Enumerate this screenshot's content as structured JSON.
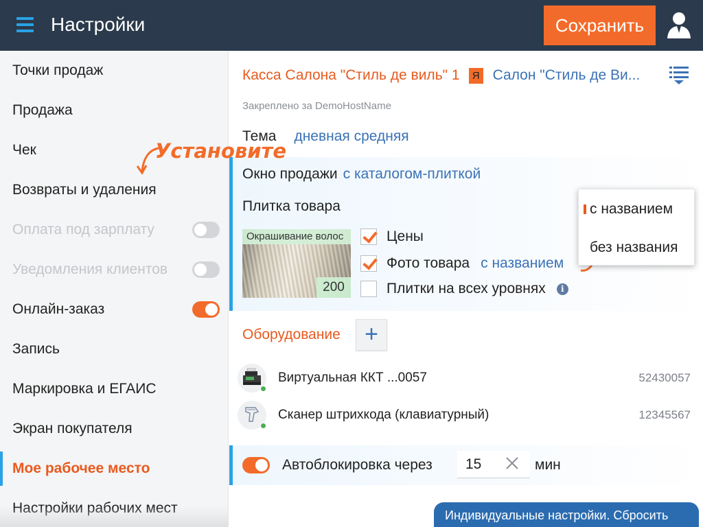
{
  "header": {
    "title": "Настройки",
    "save_label": "Сохранить"
  },
  "sidebar": {
    "items": [
      {
        "label": "Точки продаж"
      },
      {
        "label": "Продажа"
      },
      {
        "label": "Чек"
      },
      {
        "label": "Возвраты и удаления"
      },
      {
        "label": "Оплата под зарплату",
        "disabled": true,
        "toggle": false
      },
      {
        "label": "Уведомления клиентов",
        "disabled": true,
        "toggle": false
      },
      {
        "label": "Онлайн-заказ",
        "toggle": true
      },
      {
        "label": "Запись"
      },
      {
        "label": "Маркировка и ЕГАИС"
      },
      {
        "label": "Экран покупателя"
      },
      {
        "label": "Мое рабочее место",
        "active": true
      },
      {
        "label": "Настройки рабочих мест"
      }
    ]
  },
  "workplace": {
    "cash_name": "Касса Салона \"Стиль де виль\" 1",
    "badge": "Я",
    "salon": "Салон \"Стиль де Ви...",
    "pinned": "Закреплено за DemoHostName",
    "theme_label": "Тема",
    "theme_value": "дневная средняя"
  },
  "sale_window": {
    "label": "Окно продажи",
    "value": "с каталогом-плиткой",
    "tile_label": "Плитка товара",
    "hint": "Установите",
    "tile_preview": {
      "title": "Окрашивание волос",
      "price": "200"
    },
    "options": [
      {
        "label": "Цены",
        "checked": true
      },
      {
        "label": "Фото товара",
        "checked": true,
        "link": "с названием"
      },
      {
        "label": "Плитки на всех уровнях",
        "checked": false,
        "info_icon": "i"
      }
    ]
  },
  "popup": {
    "options": [
      "с названием",
      "без названия"
    ],
    "selected": "с названием"
  },
  "equipment": {
    "title": "Оборудование",
    "add_label": "+",
    "devices": [
      {
        "name": "Виртуальная ККТ ...0057",
        "serial": "52430057",
        "icon": "printer-icon",
        "status_color": "#4caf50"
      },
      {
        "name": "Сканер штрихкода (клавиатурный)",
        "serial": "12345567",
        "icon": "scanner-icon",
        "status_color": "#4caf50"
      }
    ]
  },
  "autolock": {
    "enabled": true,
    "label": "Автоблокировка через",
    "value": "15",
    "unit": "мин"
  },
  "reset_label": "Индивидуальные настройки. Сбросить",
  "colors": {
    "header_bg": "#2b3a4c",
    "accent_orange": "#f26b2a",
    "accent_blue": "#29a3e6",
    "link_blue": "#3a72b5"
  }
}
